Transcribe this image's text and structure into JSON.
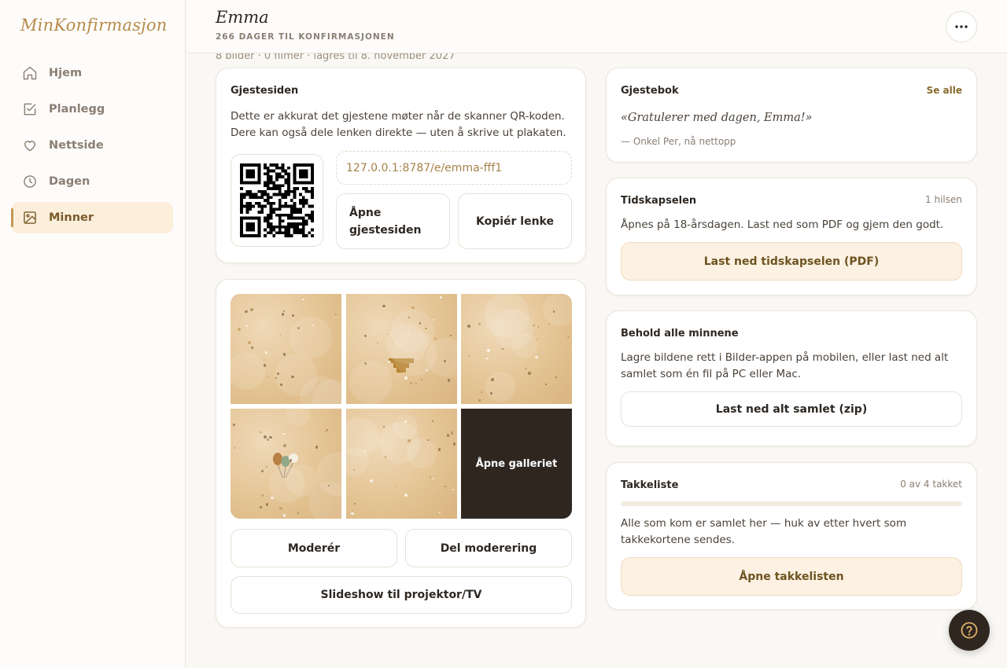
{
  "app": {
    "logo": "MinKonfirmasjon"
  },
  "sidebar": {
    "items": [
      {
        "label": "Hjem",
        "icon": "home-icon"
      },
      {
        "label": "Planlegg",
        "icon": "checklist-icon"
      },
      {
        "label": "Nettside",
        "icon": "heart-icon"
      },
      {
        "label": "Dagen",
        "icon": "clock-icon"
      },
      {
        "label": "Minner",
        "icon": "image-icon",
        "active": true
      }
    ]
  },
  "header": {
    "name": "Emma",
    "countdown": "266 DAGER TIL KONFIRMASJONEN",
    "more_icon": "more-horizontal-icon"
  },
  "summary": "8 bilder · 0 filmer · lagres til 8. november 2027",
  "guest_page": {
    "title": "Gjestesiden",
    "description": "Dette er akkurat det gjestene møter når de skanner QR-koden. Dere kan også dele lenken direkte — uten å skrive ut plakaten.",
    "url": "127.0.0.1:8787/e/emma-fff1",
    "open_button": "Åpne gjestesiden",
    "copy_button": "Kopiér lenke"
  },
  "gallery": {
    "open_label": "Åpne galleriet",
    "moderate_button": "Moderér",
    "share_moderation_button": "Del moderering",
    "slideshow_button": "Slideshow til projektor/TV"
  },
  "guestbook": {
    "title": "Gjestebok",
    "see_all": "Se alle",
    "quote": "«Gratulerer med dagen, Emma!»",
    "author": "— Onkel Per, nå nettopp"
  },
  "time_capsule": {
    "title": "Tidskapselen",
    "meta": "1 hilsen",
    "description": "Åpnes på 18-årsdagen. Last ned som PDF og gjem den godt.",
    "button": "Last ned tidskapselen (PDF)"
  },
  "keep_memories": {
    "title": "Behold alle minnene",
    "description": "Lagre bildene rett i Bilder-appen på mobilen, eller last ned alt samlet som én fil på PC eller Mac.",
    "button": "Last ned alt samlet (zip)"
  },
  "thanks_list": {
    "title": "Takkeliste",
    "meta": "0 av 4 takket",
    "progress": 0,
    "description": "Alle som kom er samlet her — huk av etter hvert som takkekortene sendes.",
    "button": "Åpne takkelisten"
  },
  "help": {
    "icon": "help-circle-icon"
  },
  "colors": {
    "accent": "#c49655",
    "dark": "#2f2620",
    "warm_button": "#fcf1e2"
  }
}
